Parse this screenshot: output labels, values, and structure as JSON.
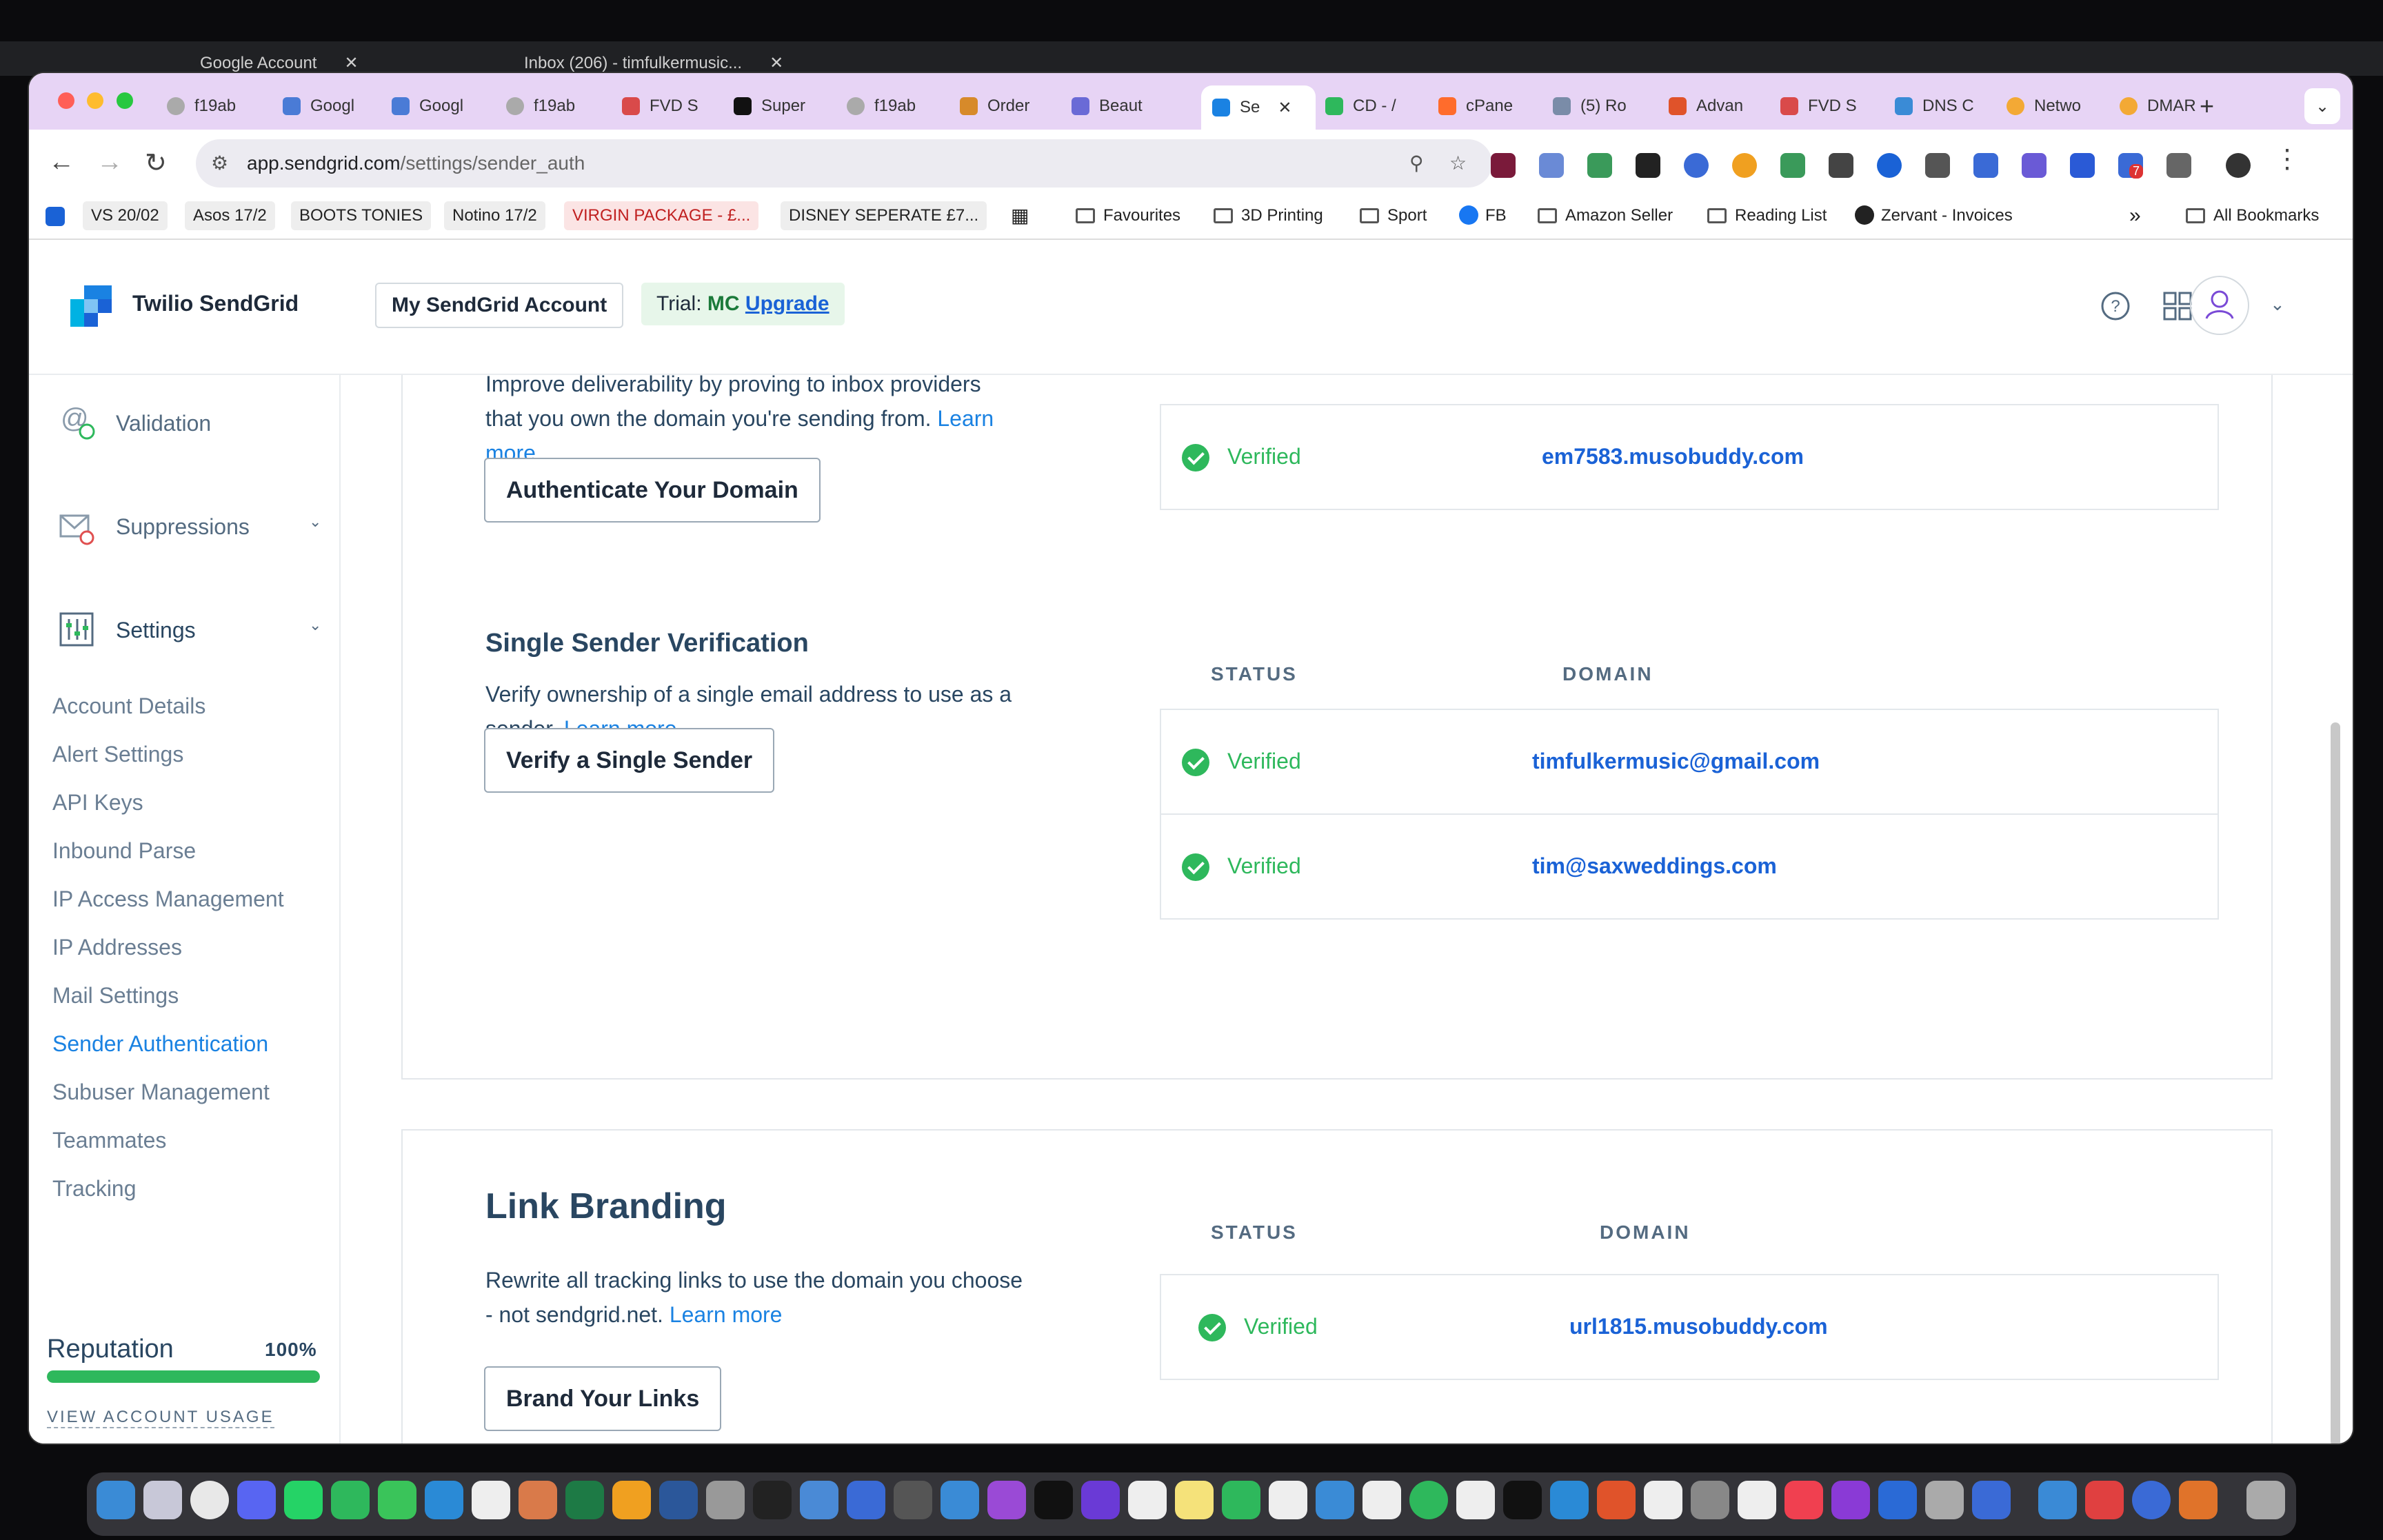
{
  "background_window": {
    "tabs": [
      "Google Account",
      "Inbox (206) - timfulkermusic..."
    ]
  },
  "browser": {
    "tabs": [
      {
        "label": "f19ab"
      },
      {
        "label": "Googl"
      },
      {
        "label": "Googl"
      },
      {
        "label": "f19ab"
      },
      {
        "label": "FVD S"
      },
      {
        "label": "Super"
      },
      {
        "label": "f19ab"
      },
      {
        "label": "Order"
      },
      {
        "label": "Beaut"
      },
      {
        "label": "Se",
        "active": true
      },
      {
        "label": "CD - /"
      },
      {
        "label": "cPane"
      },
      {
        "label": "(5) Ro"
      },
      {
        "label": "Advan"
      },
      {
        "label": "FVD S"
      },
      {
        "label": "DNS C"
      },
      {
        "label": "Netwo"
      },
      {
        "label": "DMAR"
      }
    ],
    "new_tab": "+",
    "close_tab": "✕",
    "url_host": "app.sendgrid.com",
    "url_path": "/settings/sender_auth",
    "extension_badge": "7",
    "bookmarks": [
      "VS 20/02",
      "Asos 17/2",
      "BOOTS TONIES",
      "Notino 17/2",
      "VIRGIN PACKAGE - £...",
      "DISNEY SEPERATE £7...",
      "Favourites",
      "3D Printing",
      "Sport",
      "FB",
      "Amazon Seller",
      "Reading List",
      "Zervant - Invoices",
      "»",
      "All Bookmarks"
    ]
  },
  "app": {
    "brand": "Twilio SendGrid",
    "account_button": "My SendGrid Account",
    "trial_prefix": "Trial:",
    "trial_code": "MC",
    "upgrade": "Upgrade"
  },
  "sidebar": {
    "validation": "Validation",
    "suppressions": "Suppressions",
    "settings": "Settings",
    "items": [
      "Account Details",
      "Alert Settings",
      "API Keys",
      "Inbound Parse",
      "IP Access Management",
      "IP Addresses",
      "Mail Settings",
      "Sender Authentication",
      "Subuser Management",
      "Teammates",
      "Tracking"
    ],
    "active_item": "Sender Authentication",
    "reputation_label": "Reputation",
    "reputation_value": "100%",
    "reputation_fraction": 1.0,
    "view_usage": "VIEW ACCOUNT USAGE"
  },
  "domain_auth": {
    "desc_1": "Improve deliverability by proving to inbox providers",
    "desc_2": "that you own the domain you're sending from.",
    "learn": "Learn",
    "more": "more",
    "button": "Authenticate Your Domain",
    "row": {
      "status": "Verified",
      "domain": "em7583.musobuddy.com"
    }
  },
  "single_sender": {
    "title": "Single Sender Verification",
    "desc_1": "Verify ownership of a single email address to use as a",
    "desc_2": "sender.",
    "learn_more": "Learn more",
    "button": "Verify a Single Sender",
    "col_status": "STATUS",
    "col_domain": "DOMAIN",
    "rows": [
      {
        "status": "Verified",
        "domain": "timfulkermusic@gmail.com"
      },
      {
        "status": "Verified",
        "domain": "tim@saxweddings.com"
      }
    ]
  },
  "link_branding": {
    "title": "Link Branding",
    "desc_1": "Rewrite all tracking links to use the domain you choose",
    "desc_2": "- not sendgrid.net.",
    "learn_more": "Learn more",
    "button": "Brand Your Links",
    "col_status": "STATUS",
    "col_domain": "DOMAIN",
    "row": {
      "status": "Verified",
      "domain": "url1815.musobuddy.com"
    }
  },
  "colors": {
    "accent_link": "#1a82e2",
    "verified_green": "#2eb85c",
    "text_dark": "#294661",
    "tabstrip": "#e7d4f5"
  }
}
